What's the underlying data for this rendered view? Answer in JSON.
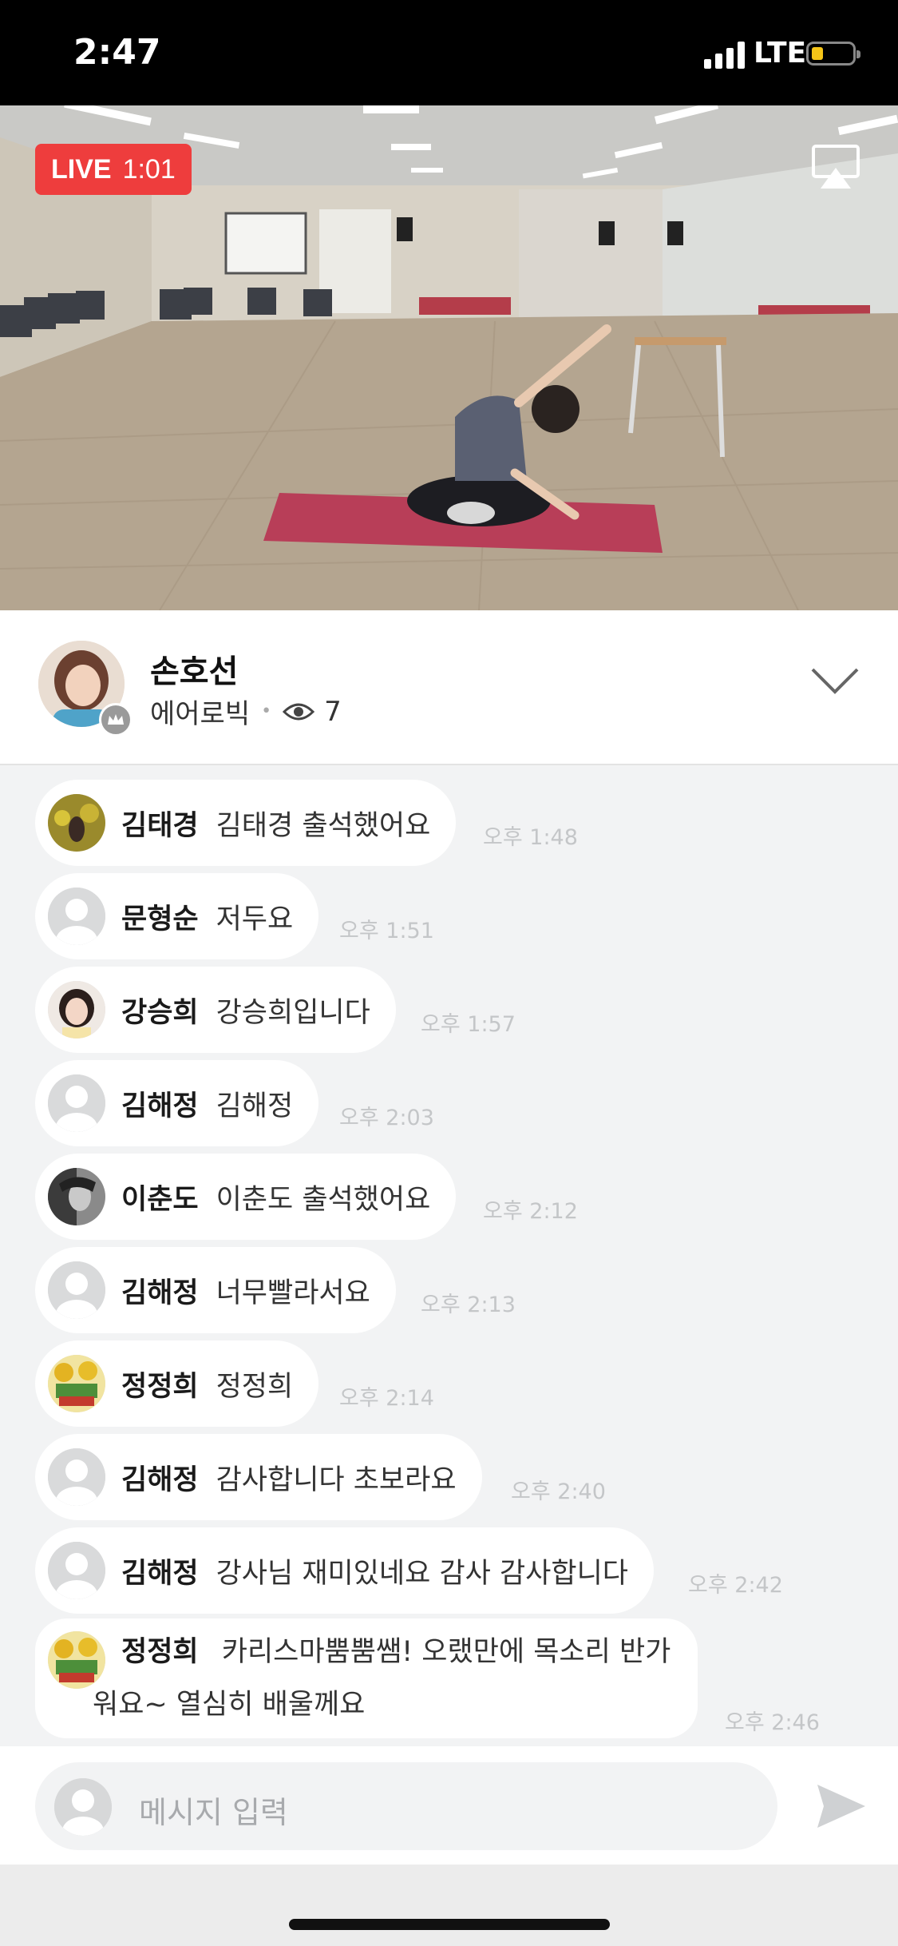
{
  "status_bar": {
    "time": "2:47",
    "network": "LTE"
  },
  "video": {
    "live_label": "LIVE",
    "live_time": "1:01"
  },
  "streamer": {
    "name": "손호선",
    "category": "에어로빅",
    "viewer_count": "7"
  },
  "messages": [
    {
      "user": "김태경",
      "text": "김태경 출석했어요",
      "time": "오후 1:48"
    },
    {
      "user": "문형순",
      "text": "저두요",
      "time": "오후 1:51"
    },
    {
      "user": "강승희",
      "text": "강승희입니다",
      "time": "오후 1:57"
    },
    {
      "user": "김해정",
      "text": "김해정",
      "time": "오후 2:03"
    },
    {
      "user": "이춘도",
      "text": "이춘도 출석했어요",
      "time": "오후 2:12"
    },
    {
      "user": "김해정",
      "text": "너무빨라서요",
      "time": "오후 2:13"
    },
    {
      "user": "정정희",
      "text": "정정희",
      "time": "오후 2:14"
    },
    {
      "user": "김해정",
      "text": "감사합니다 초보라요",
      "time": "오후 2:40"
    },
    {
      "user": "김해정",
      "text": "강사님 재미있네요 감사 감사합니다",
      "time": "오후 2:42"
    },
    {
      "user": "정정희",
      "text_line1": "카리스마뿜뿜쌤! 오랬만에 목소리 반가",
      "text_line2": "워요~ 열심히 배울께요",
      "time": "오후 2:46"
    }
  ],
  "input": {
    "placeholder": "메시지 입력"
  },
  "colors": {
    "live_red": "#ee3d3d",
    "chat_bg": "#f2f3f4",
    "timestamp": "#c4c6c8"
  },
  "icons": {
    "airplay": "airplay-icon",
    "crown": "crown-icon",
    "eye": "eye-icon",
    "collapse": "chevron-down-icon",
    "send": "send-icon"
  }
}
